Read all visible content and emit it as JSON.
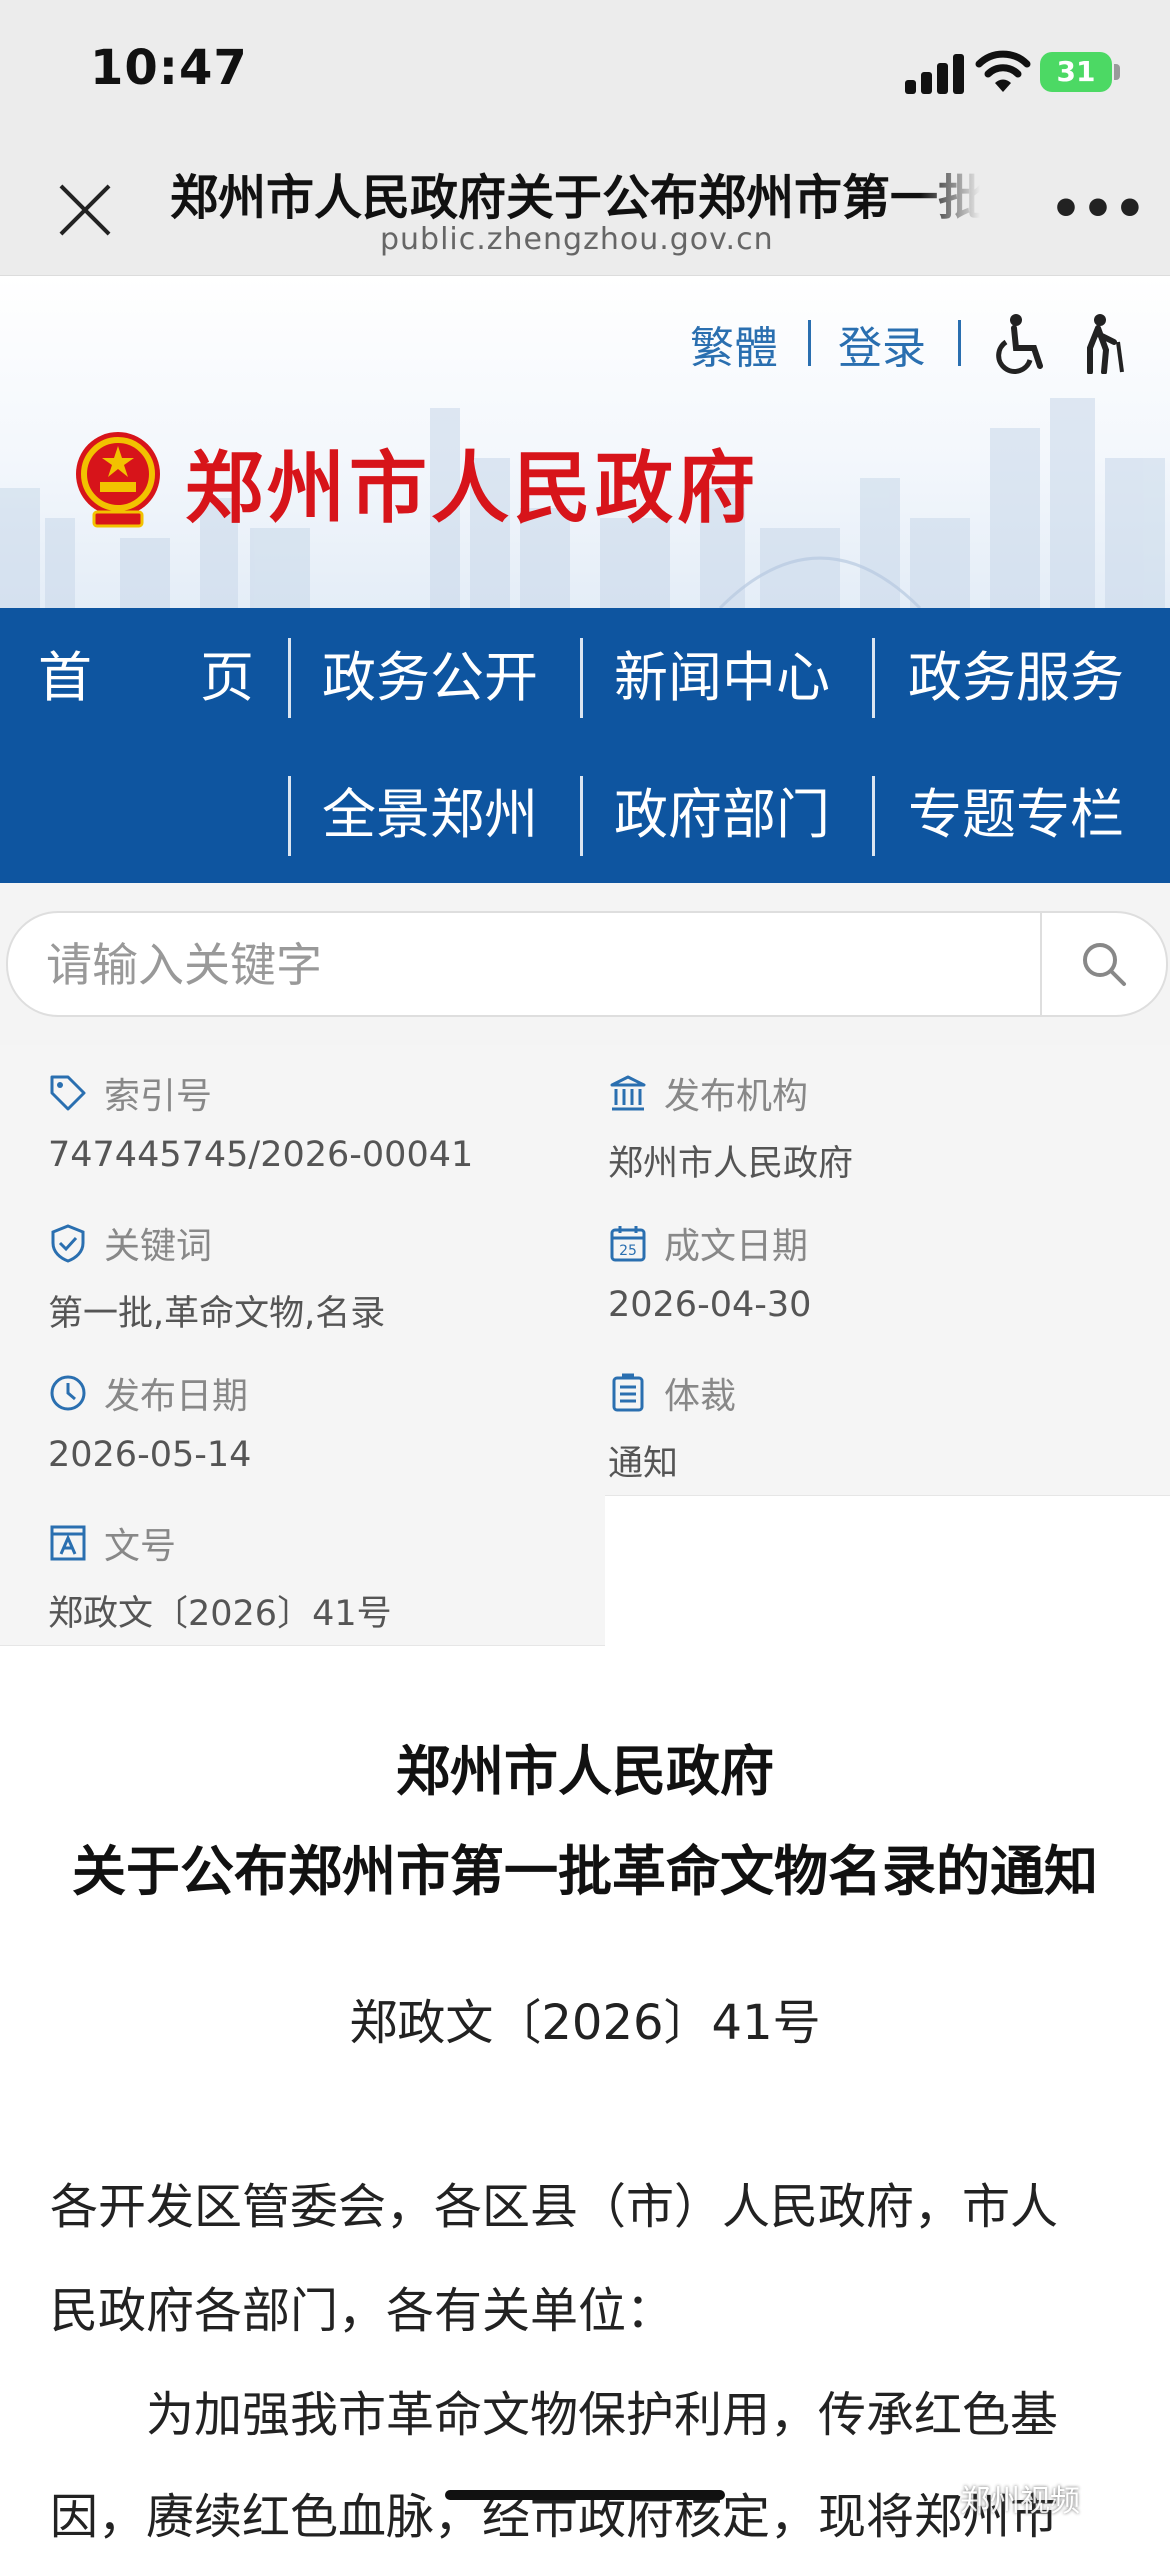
{
  "status_bar": {
    "time": "10:47",
    "battery": "31"
  },
  "browser": {
    "title": "郑州市人民政府关于公布郑州市第一批革命文物名录的通知",
    "url": "public.zhengzhou.gov.cn"
  },
  "header": {
    "traditional_label": "繁體",
    "login_label": "登录",
    "site_name": "郑州市人民政府"
  },
  "nav": {
    "items": [
      "首　　页",
      "政务公开",
      "新闻中心",
      "政务服务",
      "全景郑州",
      "政府部门",
      "专题专栏"
    ]
  },
  "search": {
    "placeholder": "请输入关键字"
  },
  "meta": {
    "index_label": "索引号",
    "index_value": "747445745/2026-00041",
    "publisher_label": "发布机构",
    "publisher_value": "郑州市人民政府",
    "keywords_label": "关键词",
    "keywords_value": "第一批,革命文物,名录",
    "written_label": "成文日期",
    "written_value": "2026-04-30",
    "published_label": "发布日期",
    "published_value": "2026-05-14",
    "genre_label": "体裁",
    "genre_value": "通知",
    "docno_label": "文号",
    "docno_value": "郑政文〔2026〕41号"
  },
  "article": {
    "title_line1": "郑州市人民政府",
    "title_line2": "关于公布郑州市第一批革命文物名录的通知",
    "doc_number": "郑政文〔2026〕41号",
    "para1_line1": "各开发区管委会，各区县（市）人民政府，市人",
    "para1_line2": "民政府各部门，各有关单位：",
    "para2_line1": "　　为加强我市革命文物保护利用，传承红色基",
    "para2_line2": "因，赓续红色血脉，经市政府核定，现将郑州市"
  },
  "watermark": "郑州视频",
  "colors": {
    "nav_blue": "#0e55a0",
    "link_blue": "#2a6fb0",
    "site_red": "#d7141a",
    "battery_green": "#4cd964"
  }
}
